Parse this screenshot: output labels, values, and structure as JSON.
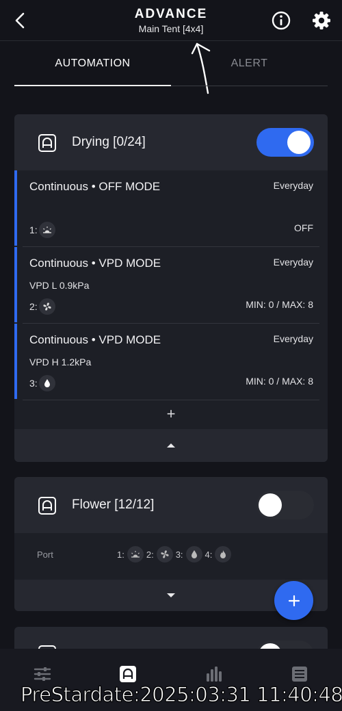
{
  "header": {
    "title": "ADVANCE",
    "subtitle": "Main Tent [4x4]"
  },
  "tabs": [
    {
      "label": "AUTOMATION",
      "active": true
    },
    {
      "label": "ALERT",
      "active": false
    }
  ],
  "cards": [
    {
      "title": "Drying [0/24]",
      "enabled": true,
      "rules": [
        {
          "title": "Continuous • OFF MODE",
          "schedule": "Everyday",
          "subtitle": "",
          "port_label": "1:",
          "port_icon": "sun-icon",
          "value": "OFF"
        },
        {
          "title": "Continuous • VPD MODE",
          "schedule": "Everyday",
          "subtitle": "VPD L 0.9kPa",
          "port_label": "2:",
          "port_icon": "fan-icon",
          "value": "MIN: 0 / MAX: 8"
        },
        {
          "title": "Continuous • VPD MODE",
          "schedule": "Everyday",
          "subtitle": "VPD H 1.2kPa",
          "port_label": "3:",
          "port_icon": "droplet-icon",
          "value": "MIN: 0 / MAX: 8"
        }
      ],
      "add_label": "+"
    },
    {
      "title": "Flower [12/12]",
      "enabled": false,
      "port_label": "Port",
      "ports": [
        {
          "label": "1:",
          "icon": "sun-icon"
        },
        {
          "label": "2:",
          "icon": "fan-icon"
        },
        {
          "label": "3:",
          "icon": "droplet-icon"
        },
        {
          "label": "4:",
          "icon": "flame-icon"
        }
      ]
    }
  ],
  "fab_label": "+",
  "bottom_nav": [
    {
      "icon": "sliders-icon",
      "active": false
    },
    {
      "icon": "automation-icon",
      "active": true
    },
    {
      "icon": "chart-icon",
      "active": false
    },
    {
      "icon": "log-icon",
      "active": false
    }
  ],
  "watermark": "PreStardate:2025:03:31 11:40:48",
  "colors": {
    "accent": "#2f6af0",
    "background": "#13141a",
    "card": "#1d1f26"
  }
}
